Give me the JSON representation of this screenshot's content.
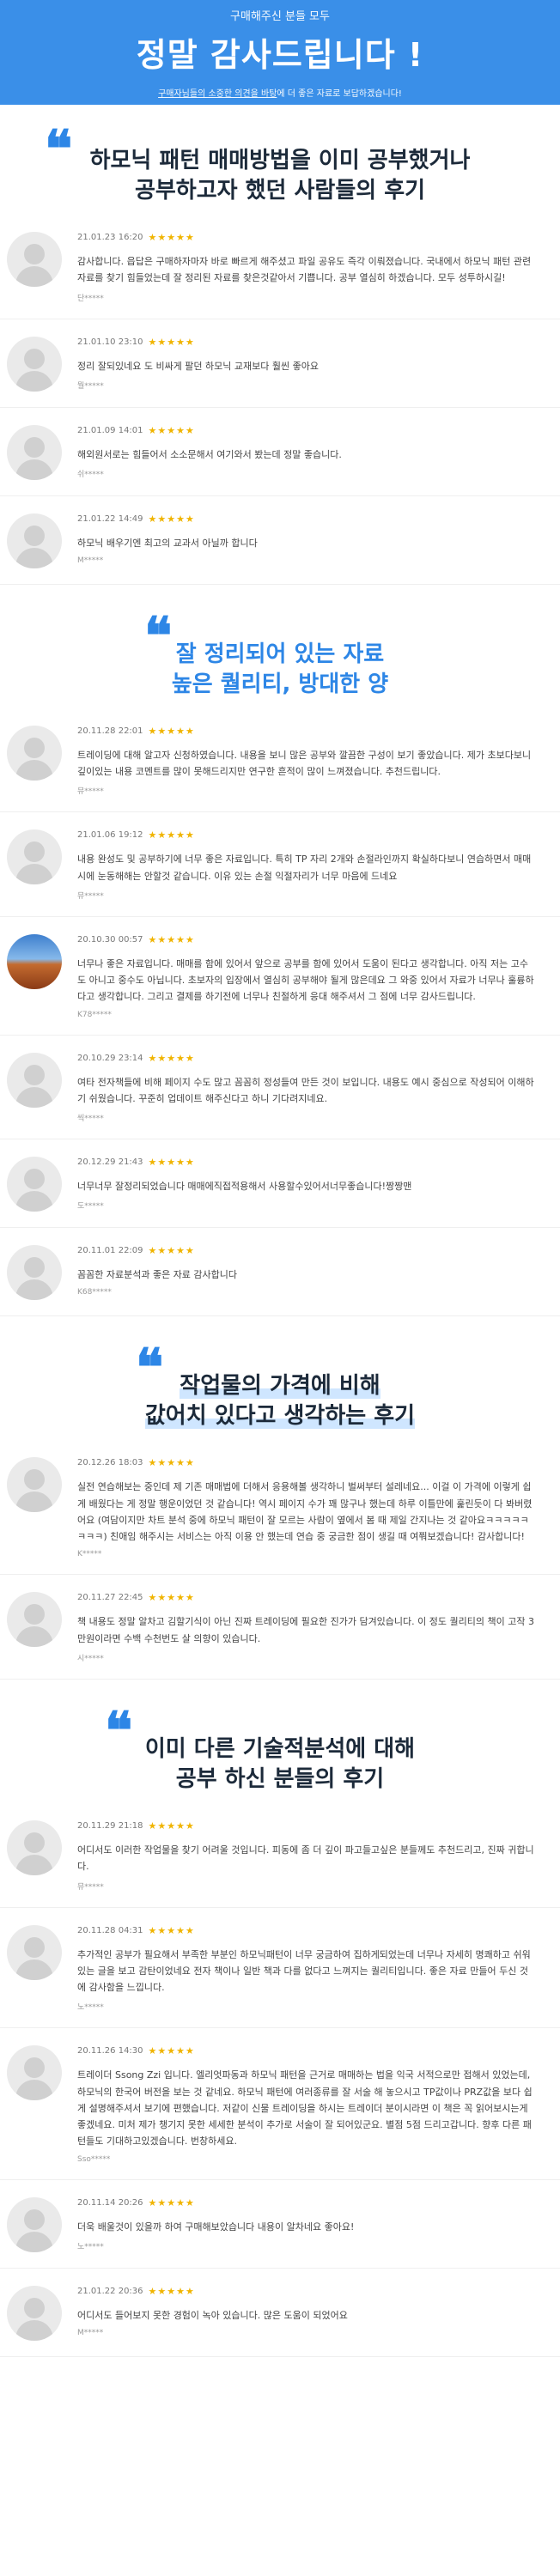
{
  "header": {
    "kicker": "구매해주신 분들 모두",
    "title": "정말 감사드립니다 !",
    "sub_prefix": "구매자님들의 소중한 의견을 바탕",
    "sub_suffix": "에 더 좋은 자료로 보답하겠습니다!"
  },
  "sections": [
    {
      "title_line1": "하모닉 패턴 매매방법을 이미 공부했거나",
      "title_line2": "공부하고자 했던 사람들의 후기",
      "reviews": [
        {
          "date": "21.01.23 16:20",
          "stars": "★★★★★",
          "text": "감사합니다. 읍답은 구매하자마자 바로 빠르게 해주셨고 파일 공유도 즉각 이뤄졌습니다. 국내에서 하모닉 패턴 관련 자료를 찾기 힘들었는데 잘 정리된 자료를 찾은것같아서 기쁩니다. 공부 열심히 하겠습니다. 모두 성투하시길!",
          "user": "단*****"
        },
        {
          "date": "21.01.10 23:10",
          "stars": "★★★★★",
          "text": "정리 잘되있네요 도 비싸게 팔던 하모닉 교재보다 훨씬 좋아요",
          "user": "뭘*****"
        },
        {
          "date": "21.01.09 14:01",
          "stars": "★★★★★",
          "text": "해외원서로는 힘들어서 소소문해서 여기와서 봤는데 정말 좋습니다.",
          "user": "쉬*****"
        },
        {
          "date": "21.01.22 14:49",
          "stars": "★★★★★",
          "text": "하모닉 배우기엔 최고의 교과서 아닐까 합니다",
          "user": "M*****"
        }
      ]
    },
    {
      "title_line1": "잘 정리되어 있는 자료",
      "title_line2": "높은 퀄리티, 방대한 양",
      "reviews": [
        {
          "date": "20.11.28 22:01",
          "stars": "★★★★★",
          "text": "트레이딩에 대해 알고자 신청하였습니다. 내용을 보니 많은 공부와 깔끔한 구성이 보기 좋았습니다. 제가 초보다보니 깊이있는 내용 코멘트를 많이 못해드리지만 연구한 흔적이 많이 느껴졌습니다. 추천드립니다.",
          "user": "뮤*****"
        },
        {
          "date": "21.01.06 19:12",
          "stars": "★★★★★",
          "text": "내용 완성도 및 공부하기에 너무 좋은 자료입니다. 특히 TP 자리 2개와 손절라인까지 확실하다보니 연습하면서 매매시에 눈동해해는 안할것 같습니다. 이유 있는 손절 익절자리가 너무 마음에 드네요",
          "user": "뮤*****"
        },
        {
          "date": "20.10.30 00:57",
          "stars": "★★★★★",
          "text": "너무나 좋은 자료입니다. 매매를 함에 있어서 앞으로 공부를 함에 있어서 도움이 된다고 생각합니다. 아직 저는 고수도 아니고 중수도 아닙니다. 초보자의 입장에서 열심히 공부해야 될게 많은데요 그 와중 있어서 자료가 너무나 훌륭하다고 생각합니다. 그리고 결제를 하기전에 너무나 친절하게 응대 해주셔서 그 점에 너무 감사드립니다.",
          "user": "K78*****",
          "photo": true
        },
        {
          "date": "20.10.29 23:14",
          "stars": "★★★★★",
          "text": "여타 전자책들에 비해 페이지 수도 많고 꼼꼼히 정성들여 만든 것이 보입니다. 내용도 예시 중심으로 작성되어 이해하기 쉬웠습니다. 꾸준히 업데이트 해주신다고 하니 기다려지네요.",
          "user": "씩*****"
        },
        {
          "date": "20.12.29 21:43",
          "stars": "★★★★★",
          "text": "너무너무 잘정리되었습니다 매매에직접적용해서 사용할수있어서너무좋습니다!짱짱맨",
          "user": "도*****"
        },
        {
          "date": "20.11.01 22:09",
          "stars": "★★★★★",
          "text": "꼼꼼한 자료분석과 좋은 자료 감사합니다",
          "user": "K68*****"
        }
      ]
    },
    {
      "title_line1": "작업물의 가격에 비해",
      "title_line2": "값어치 있다고  생각하는 후기",
      "reviews": [
        {
          "date": "20.12.26 18:03",
          "stars": "★★★★★",
          "text": "실전 연습해보는 중인데 제 기존 매매법에 더해서 응용해볼 생각하니 벌써부터 설레네요... 이걸 이 가격에 이렇게 쉽게 배웠다는 게 정말 행운이었던 것 같습니다! 역시 페이지 수가 꽤 많구나 했는데 하루 이틀만에 훑린듯이 다 봐버렸어요 (여담이지만 차트 분석 중에 하모닉 패턴이 잘 모르는 사람이 옆에서 봄 때 제일 간지나는 것 같아요ㅋㅋㅋㅋㅋㅋㅋㅋ) 친애임 해주시는 서비스는 아직 이용 안 했는데 연습 중 궁금한 점이 생길 때 여쭤보겠습니다! 감사합니다!",
          "user": "K*****"
        },
        {
          "date": "20.11.27 22:45",
          "stars": "★★★★★",
          "text": "책 내용도 정말 알차고 김할기식이 아닌 진짜 트레이딩에 필요한 진가가 담겨있습니다. 이 정도 퀄리티의 책이 고작 3만원이라면 수백 수천번도 살 의향이 있습니다.",
          "user": "시*****"
        }
      ]
    },
    {
      "title_line1": "이미 다른 기술적분석에 대해",
      "title_line2": "공부 하신 분들의 후기",
      "reviews": [
        {
          "date": "20.11.29 21:18",
          "stars": "★★★★★",
          "text": "어디서도 이러한 작업물을 찾기 어려울 것입니다. 피동에 좀 더 깊이 파고들고싶은 분들께도 추천드리고, 진짜 귀합니다.",
          "user": "뮤*****"
        },
        {
          "date": "20.11.28 04:31",
          "stars": "★★★★★",
          "text": "추가적인 공부가 필요해서 부족한 부분인 하모닉패턴이 너무 궁금하여 집하게되었는데 너무나 자세히 명쾌하고 쉬워있는 글을 보고 감탄이었네요 전자 책이나 일반 책과 다를 없다고 느껴지는 퀄리티입니다. 좋은 자료 만들어 두신 것에 감사함을 느낍니다.",
          "user": "노*****"
        },
        {
          "date": "20.11.26 14:30",
          "stars": "★★★★★",
          "text": "트레이더 Ssong Zzi 입니다. 엘리엇파동과 하모닉 패턴을 근거로 매매하는 법을 익국 서적으로만 접해서 있었는데, 하모닉의 한국어 버전을 보는 것 같네요. 하모닉 패턴에 여러종류를 잘 서술 해 놓으시고 TP값이나 PRZ값을 보다 쉽게 설명해주셔서 보기에 편했습니다. 저같이 신물 트레이딩을 하시는 트레이더 분이시라면 이 책은 꼭 읽어보시는게 좋겠네요. 미처 제가 챙기지 못한 세세한 분석이 추가로 서술이 잘 되어있군요. 별점 5점 드리고갑니다. 향후 다른 패턴들도 기대하고있겠습니다. 번창하세요.",
          "user": "Sso*****"
        },
        {
          "date": "20.11.14 20:26",
          "stars": "★★★★★",
          "text": "더욱 배울것이 있을까 하여 구매해보았습니다 내용이 알차네요 좋아요!",
          "user": "노*****"
        },
        {
          "date": "21.01.22 20:36",
          "stars": "★★★★★",
          "text": "어디서도 들어보지 못한 경험이 녹아 있습니다. 많은 도움이 되었어요",
          "user": "M*****"
        }
      ]
    }
  ]
}
